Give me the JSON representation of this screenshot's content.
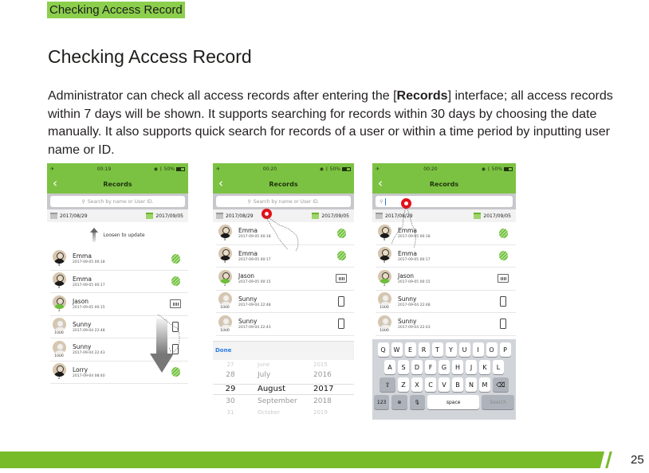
{
  "header_tag": "Checking Access Record",
  "page_title": "Checking Access Record",
  "intro": {
    "part1": "Administrator can check all access records after entering the [",
    "bold": "Records",
    "part2": "] interface; all access records within 7 days will be shown. It supports searching for records within 30 days by choosing the date manually. It also supports quick search for records of a user or within a time period by inputting user name or ID."
  },
  "phones": [
    {
      "status": {
        "airplane": "✈",
        "time": "00:19",
        "battery": "50%"
      },
      "nav_title": "Records",
      "back_icon": "‹",
      "search_placeholder": "Search by name or User ID.",
      "date_from": "2017/08/29",
      "date_to": "2017/09/05",
      "pull_label": "Loosen to update",
      "records": [
        {
          "name": "Emma",
          "time": "2017-09-05 00:18",
          "uid": "4",
          "type": "fingerprint"
        },
        {
          "name": "Emma",
          "time": "2017-09-05 00:17",
          "uid": "4",
          "type": "fingerprint"
        },
        {
          "name": "Jason",
          "time": "2017-09-05 00:15",
          "uid": "1",
          "type": "card"
        },
        {
          "name": "Sunny",
          "time": "2017-09-04 22:48",
          "uid": "1000",
          "type": "mobile"
        },
        {
          "name": "Sunny",
          "time": "2017-09-04 22:43",
          "uid": "1000",
          "type": "mobile"
        },
        {
          "name": "Lorry",
          "time": "2017-09-04 08:40",
          "uid": "2",
          "type": "fingerprint"
        }
      ]
    },
    {
      "status": {
        "airplane": "✈",
        "time": "00:20",
        "battery": "50%"
      },
      "nav_title": "Records",
      "back_icon": "‹",
      "search_placeholder": "Search by name or User ID.",
      "date_from": "2017/08/29",
      "date_to": "2017/09/05",
      "records": [
        {
          "name": "Emma",
          "time": "2017-09-05 00:18",
          "uid": "4",
          "type": "fingerprint"
        },
        {
          "name": "Emma",
          "time": "2017-09-05 00:17",
          "uid": "4",
          "type": "fingerprint"
        },
        {
          "name": "Jason",
          "time": "2017-09-05 00:15",
          "uid": "1",
          "type": "card"
        },
        {
          "name": "Sunny",
          "time": "2017-09-04 22:48",
          "uid": "1000",
          "type": "mobile"
        },
        {
          "name": "Sunny",
          "time": "2017-09-04 22:43",
          "uid": "1000",
          "type": "mobile"
        }
      ],
      "done_label": "Done",
      "picker": {
        "rows": [
          {
            "day": "27",
            "month": "June",
            "year": "2015"
          },
          {
            "day": "28",
            "month": "July",
            "year": "2016"
          },
          {
            "day": "29",
            "month": "August",
            "year": "2017"
          },
          {
            "day": "30",
            "month": "September",
            "year": "2018"
          },
          {
            "day": "31",
            "month": "October",
            "year": "2019"
          }
        ],
        "selected_index": 2
      }
    },
    {
      "status": {
        "airplane": "✈",
        "time": "00:20",
        "battery": "50%"
      },
      "nav_title": "Records",
      "back_icon": "‹",
      "search_placeholder": "",
      "date_from": "2017/08/29",
      "date_to": "2017/09/05",
      "records": [
        {
          "name": "Emma",
          "time": "2017-09-05 00:18",
          "uid": "4",
          "type": "fingerprint"
        },
        {
          "name": "Emma",
          "time": "2017-09-05 00:17",
          "uid": "4",
          "type": "fingerprint"
        },
        {
          "name": "Jason",
          "time": "2017-09-05 00:15",
          "uid": "1",
          "type": "card"
        },
        {
          "name": "Sunny",
          "time": "2017-09-04 22:48",
          "uid": "1000",
          "type": "mobile"
        },
        {
          "name": "Sunny",
          "time": "2017-09-04 22:43",
          "uid": "1000",
          "type": "mobile"
        }
      ],
      "keyboard": {
        "row1": [
          "Q",
          "W",
          "E",
          "R",
          "T",
          "Y",
          "U",
          "I",
          "O",
          "P"
        ],
        "row2": [
          "A",
          "S",
          "D",
          "F",
          "G",
          "H",
          "J",
          "K",
          "L"
        ],
        "row3": [
          "Z",
          "X",
          "C",
          "V",
          "B",
          "N",
          "M"
        ],
        "numbers_key": "123",
        "space_key": "space",
        "search_key": "Search"
      }
    }
  ],
  "footer": {
    "page_number": "25"
  },
  "colors": {
    "brand_green": "#7cc242",
    "footer_green": "#78bb29",
    "tag_green": "#8bcf4c",
    "touch_red": "#e3101a",
    "link_blue": "#2a7be4"
  }
}
